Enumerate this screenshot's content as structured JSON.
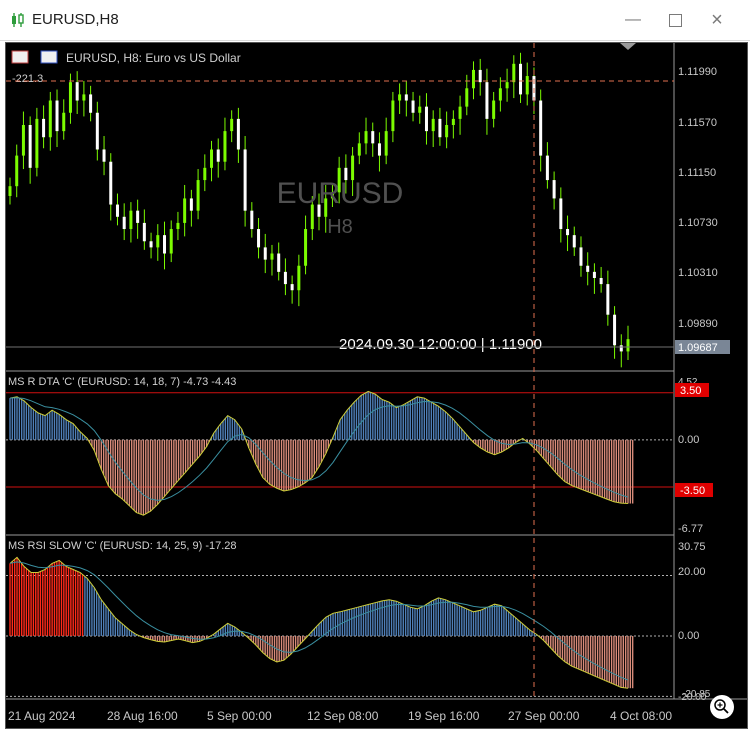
{
  "window": {
    "title": "EURUSD,H8",
    "minimize_icon": "minimize-icon",
    "maximize_icon": "maximize-icon",
    "close_icon": "close-icon"
  },
  "main_pane": {
    "header": "EURUSD, H8:  Euro vs US Dollar",
    "watermark_symbol": "EURUSD",
    "watermark_period": "H8",
    "top_left_value": "-221.3",
    "price_labels": [
      "1.11990",
      "1.11570",
      "1.11150",
      "1.10730",
      "1.10310",
      "1.09890"
    ],
    "current_price": "1.09687",
    "crosshair_readout": "2024.09.30 12:00:00 | 1.11900"
  },
  "indicator1": {
    "header": "MS R DTA 'C' (EURUSD: 14, 18, 7) -4.73 -4.43",
    "levels": [
      "4.52",
      "3.50",
      "0.00",
      "-3.50",
      "-6.77"
    ]
  },
  "indicator2": {
    "header": "MS RSI SLOW 'C' (EURUSD: 14, 25, 9) -17.28",
    "levels": [
      "30.75",
      "20.00",
      "0.00",
      "-20.00",
      "-20.85"
    ]
  },
  "time_axis": [
    "21 Aug 2024",
    "28 Aug 16:00",
    "5 Sep 00:00",
    "12 Sep 08:00",
    "19 Sep 16:00",
    "27 Sep 00:00",
    "4 Oct 08:00"
  ],
  "zoom_icon": "zoom-icon",
  "colors": {
    "bull": "#7CFC00",
    "bear": "#ffffff",
    "hist_up": "#4f7fb8",
    "hist_down": "#d98b7a",
    "rsi_high": "#ff2a1a",
    "level_line": "#d01010",
    "signal": "#cfcf3a",
    "crosshair": "#e07050",
    "axis_text": "#c8c8c8"
  },
  "chart_data": [
    {
      "type": "candlestick",
      "symbol": "EURUSD",
      "timeframe": "H8",
      "y_ticks": [
        1.1199,
        1.1157,
        1.1115,
        1.1073,
        1.1031,
        1.0989
      ],
      "ylim": [
        1.0954,
        1.1222
      ],
      "close_series": [
        1.1105,
        1.113,
        1.1155,
        1.112,
        1.116,
        1.1145,
        1.1175,
        1.115,
        1.1165,
        1.119,
        1.1175,
        1.118,
        1.1165,
        1.1135,
        1.1125,
        1.109,
        1.108,
        1.107,
        1.1085,
        1.1075,
        1.106,
        1.1055,
        1.1065,
        1.105,
        1.107,
        1.1075,
        1.1095,
        1.1085,
        1.111,
        1.112,
        1.1135,
        1.1125,
        1.115,
        1.116,
        1.1135,
        1.1085,
        1.107,
        1.1055,
        1.1045,
        1.105,
        1.1035,
        1.1025,
        1.102,
        1.104,
        1.107,
        1.109,
        1.108,
        1.1095,
        1.11,
        1.112,
        1.111,
        1.113,
        1.114,
        1.115,
        1.114,
        1.113,
        1.115,
        1.1175,
        1.118,
        1.1175,
        1.1165,
        1.117,
        1.115,
        1.116,
        1.1145,
        1.1155,
        1.116,
        1.117,
        1.1185,
        1.12,
        1.119,
        1.116,
        1.1175,
        1.1185,
        1.119,
        1.1205,
        1.118,
        1.1195,
        1.1175,
        1.113,
        1.111,
        1.1095,
        1.107,
        1.1065,
        1.1055,
        1.104,
        1.1035,
        1.103,
        1.1025,
        1.1,
        1.0975,
        1.097,
        1.098
      ]
    },
    {
      "type": "histogram_with_lines",
      "name": "MS R DTA 'C'",
      "levels": [
        3.5,
        0,
        -3.5
      ],
      "ylim": [
        -6.77,
        4.52
      ],
      "values": [
        3.1,
        3.2,
        2.9,
        2.4,
        2.0,
        1.8,
        2.2,
        1.9,
        1.5,
        1.2,
        0.6,
        0.1,
        -0.8,
        -2.2,
        -3.4,
        -4.0,
        -4.4,
        -4.9,
        -5.4,
        -5.6,
        -5.3,
        -4.8,
        -4.2,
        -3.6,
        -3.0,
        -2.4,
        -1.8,
        -1.2,
        -0.5,
        0.5,
        1.2,
        1.8,
        1.5,
        0.8,
        -0.6,
        -1.8,
        -2.8,
        -3.3,
        -3.6,
        -3.8,
        -3.7,
        -3.5,
        -3.2,
        -2.8,
        -2.0,
        -1.0,
        0.2,
        1.5,
        2.2,
        2.8,
        3.3,
        3.6,
        3.4,
        3.0,
        2.8,
        2.4,
        2.6,
        2.9,
        3.2,
        3.1,
        2.8,
        2.5,
        2.1,
        1.6,
        1.0,
        0.4,
        -0.2,
        -0.6,
        -0.9,
        -1.1,
        -0.9,
        -0.6,
        -0.2,
        0.1,
        -0.3,
        -0.8,
        -1.4,
        -2.0,
        -2.6,
        -3.1,
        -3.4,
        -3.6,
        -3.8,
        -4.0,
        -4.2,
        -4.4,
        -4.6,
        -4.7,
        -4.73
      ]
    },
    {
      "type": "histogram_with_lines",
      "name": "MS RSI SLOW 'C'",
      "levels": [
        20,
        0,
        -20
      ],
      "ylim": [
        -20.85,
        30.75
      ],
      "values": [
        24,
        26,
        23,
        21,
        21,
        22,
        24,
        25,
        23,
        22,
        21,
        19,
        16,
        12,
        9,
        6,
        4,
        2,
        0.5,
        -0.5,
        -1.2,
        -1.8,
        -2.0,
        -1.5,
        -1.0,
        -1.6,
        -2.2,
        -1.8,
        -0.8,
        0.6,
        2.4,
        4.2,
        3.0,
        1.2,
        -0.8,
        -3.0,
        -5.5,
        -7.5,
        -8.6,
        -8.0,
        -6.0,
        -3.5,
        -1.0,
        1.5,
        4.0,
        6.2,
        7.5,
        8.0,
        8.6,
        9.2,
        9.8,
        10.4,
        11.0,
        11.6,
        12.0,
        11.5,
        10.5,
        9.5,
        9.0,
        10.0,
        11.5,
        12.6,
        12.0,
        11.0,
        10.0,
        9.0,
        8.0,
        8.5,
        9.5,
        10.5,
        10.0,
        8.0,
        6.0,
        4.0,
        2.0,
        0.5,
        -1.5,
        -4,
        -6.5,
        -8.5,
        -10,
        -11,
        -12,
        -13,
        -14,
        -15,
        -16,
        -17,
        -17.28
      ]
    }
  ]
}
